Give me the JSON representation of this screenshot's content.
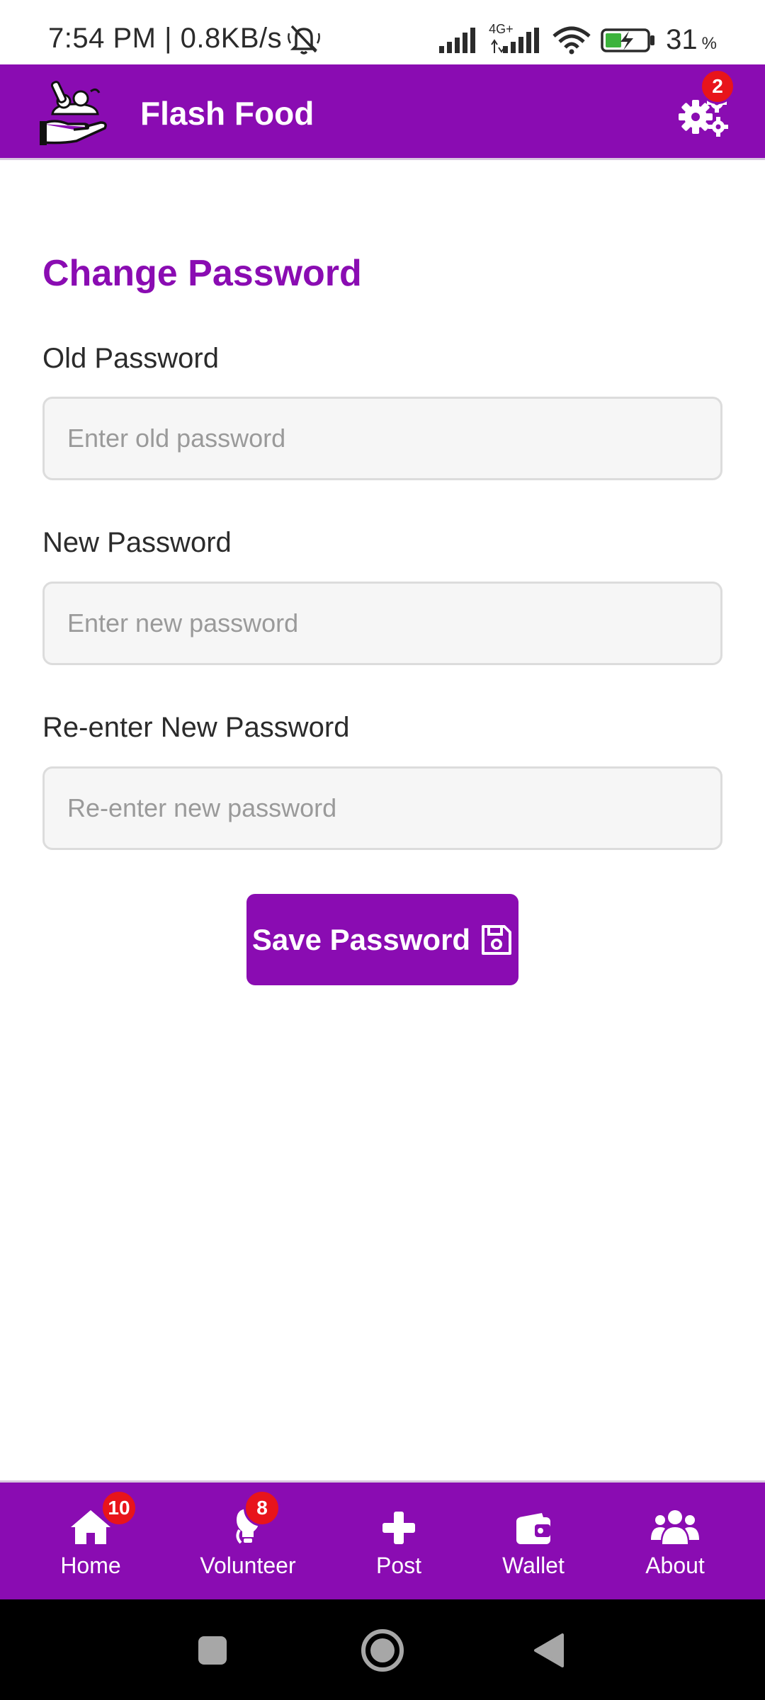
{
  "status_bar": {
    "time_text": "7:54 PM | 0.8KB/s",
    "battery_percent": "31",
    "battery_symbol": "%",
    "network_label": "4G+"
  },
  "app_bar": {
    "title": "Flash Food",
    "settings_badge": "2"
  },
  "form": {
    "title": "Change Password",
    "old_password": {
      "label": "Old Password",
      "placeholder": "Enter old password",
      "value": ""
    },
    "new_password": {
      "label": "New Password",
      "placeholder": "Enter new password",
      "value": ""
    },
    "confirm_password": {
      "label": "Re-enter New Password",
      "placeholder": "Re-enter new password",
      "value": ""
    },
    "save_label": "Save Password"
  },
  "bottom_nav": {
    "items": [
      {
        "label": "Home",
        "icon": "home-icon",
        "badge": "10"
      },
      {
        "label": "Volunteer",
        "icon": "volunteer-icon",
        "badge": "8"
      },
      {
        "label": "Post",
        "icon": "plus-icon"
      },
      {
        "label": "Wallet",
        "icon": "wallet-icon"
      },
      {
        "label": "About",
        "icon": "users-icon"
      }
    ]
  },
  "colors": {
    "accent": "#8a0cb2",
    "badge": "#e8141b",
    "input_bg": "#f6f6f6"
  }
}
